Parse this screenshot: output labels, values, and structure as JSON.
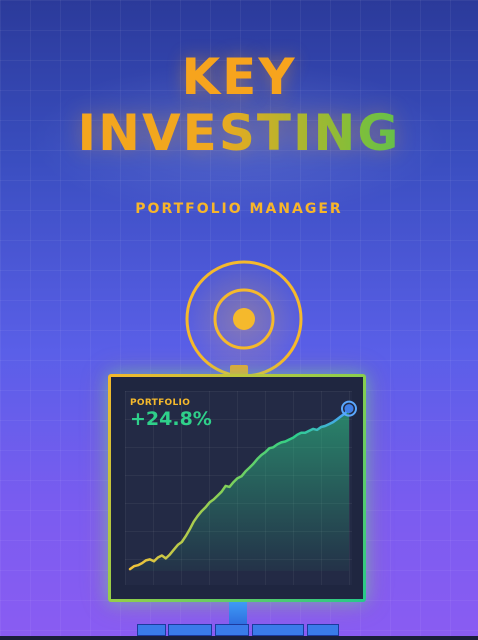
{
  "hero": {
    "title_line1": "KEY",
    "title_line2": "INVESTING",
    "subtitle": "PORTFOLIO MANAGER"
  },
  "icons": {
    "target": "target-icon"
  },
  "colors": {
    "accent_orange": "#f7a41d",
    "accent_green": "#2fd08a",
    "monitor_bg": "#1f2640",
    "background_top": "#2b3a9a",
    "background_bottom": "#8a5cf2"
  },
  "monitor": {
    "label": "PORTFOLIO",
    "value": "+24.8%"
  },
  "chart_data": {
    "type": "area",
    "x": [
      0,
      1,
      2,
      3,
      4,
      5,
      6,
      7,
      8,
      9,
      10,
      11,
      12,
      13,
      14,
      15,
      16,
      17,
      18,
      19,
      20,
      21,
      22,
      23,
      24,
      25,
      26,
      27,
      28,
      29,
      30,
      31,
      32,
      33,
      34,
      35,
      36,
      37,
      38,
      39,
      40,
      41,
      42,
      43,
      44,
      45,
      46,
      47,
      48,
      49,
      50,
      51,
      52,
      53,
      54,
      55
    ],
    "values": [
      2,
      5,
      6,
      8,
      11,
      12,
      10,
      14,
      16,
      13,
      17,
      22,
      27,
      30,
      36,
      43,
      51,
      57,
      62,
      66,
      71,
      74,
      78,
      82,
      88,
      87,
      92,
      96,
      98,
      103,
      107,
      111,
      116,
      120,
      123,
      127,
      128,
      131,
      133,
      134,
      136,
      138,
      141,
      143,
      143,
      145,
      147,
      146,
      149,
      150,
      152,
      154,
      157,
      160,
      163,
      168
    ],
    "ylim": [
      0,
      180
    ]
  }
}
